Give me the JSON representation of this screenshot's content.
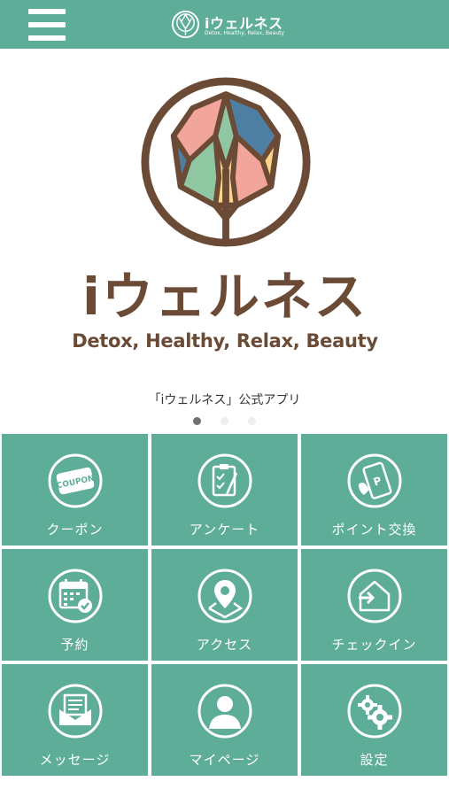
{
  "header": {
    "title": "iウェルネス",
    "subtitle": "Detox, Healthy, Relax, Beauty"
  },
  "hero": {
    "title": "iウェルネス",
    "tagline": "Detox, Healthy, Relax, Beauty"
  },
  "slider": {
    "caption": "「iウェルネス」公式アプリ",
    "active_index": 0,
    "count": 3
  },
  "menu": {
    "items": [
      {
        "label": "クーポン",
        "icon": "coupon-icon",
        "coupon_text": "COUPON"
      },
      {
        "label": "アンケート",
        "icon": "survey-clipboard-icon"
      },
      {
        "label": "ポイント交換",
        "icon": "point-exchange-phone-icon",
        "badge": "P"
      },
      {
        "label": "予約",
        "icon": "calendar-reservation-icon"
      },
      {
        "label": "アクセス",
        "icon": "map-pin-icon"
      },
      {
        "label": "チェックイン",
        "icon": "checkin-door-icon"
      },
      {
        "label": "メッセージ",
        "icon": "message-envelope-icon"
      },
      {
        "label": "マイページ",
        "icon": "user-profile-icon"
      },
      {
        "label": "設定",
        "icon": "settings-gears-icon"
      }
    ]
  },
  "colors": {
    "brand": "#5ead98",
    "logo_brown": "#6b4a36"
  }
}
